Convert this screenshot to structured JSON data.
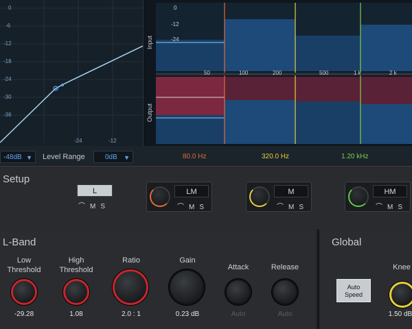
{
  "curve": {
    "y_ticks": [
      "0",
      "-6",
      "-12",
      "-18",
      "-24",
      "-30",
      "-36"
    ],
    "x_ticks": [
      "-24",
      "-12"
    ]
  },
  "spectrum": {
    "input_label": "Input",
    "output_label": "Output",
    "db_ticks": [
      "0",
      "-12",
      "-24"
    ],
    "freq_ticks": [
      "50",
      "100",
      "200",
      "500",
      "1 k",
      "2 k"
    ]
  },
  "range": {
    "low_value": "-48dB",
    "label": "Level Range",
    "high_value": "0dB"
  },
  "crossovers": [
    {
      "label": "80.0 Hz",
      "color": "#e36b3a"
    },
    {
      "label": "320.0 Hz",
      "color": "#e8cf3a"
    },
    {
      "label": "1.20 kHz",
      "color": "#7fd04a"
    }
  ],
  "setup": {
    "title": "Setup",
    "bands": [
      {
        "label": "L",
        "active": true,
        "knob_color": "",
        "controls": [
          "⌒",
          "M",
          "S"
        ]
      },
      {
        "label": "LM",
        "active": false,
        "knob_color": "#e36b3a",
        "controls": [
          "⌒",
          "M",
          "S"
        ]
      },
      {
        "label": "M",
        "active": false,
        "knob_color": "#e8cf3a",
        "controls": [
          "⌒",
          "M",
          "S"
        ]
      },
      {
        "label": "HM",
        "active": false,
        "knob_color": "#5ec84a",
        "controls": [
          "⌒",
          "M",
          "S"
        ]
      }
    ]
  },
  "lband": {
    "title": "L-Band",
    "knobs": [
      {
        "label": "Low\nThreshold",
        "value": "-29.28",
        "ring": "#c8252d"
      },
      {
        "label": "High\nThreshold",
        "value": "1.08",
        "ring": "#c8252d"
      },
      {
        "label": "Ratio",
        "value": "2.0 : 1",
        "ring": "#c8252d"
      },
      {
        "label": "Gain",
        "value": "0.23 dB",
        "ring": ""
      },
      {
        "label": "Attack",
        "value": "Auto",
        "ring": ""
      },
      {
        "label": "Release",
        "value": "Auto",
        "ring": ""
      }
    ]
  },
  "global": {
    "title": "Global",
    "auto_speed": "Auto\nSpeed",
    "knee_label": "Knee",
    "knee_value": "1.50 dB",
    "knee_ring": "#e8cf3a"
  }
}
